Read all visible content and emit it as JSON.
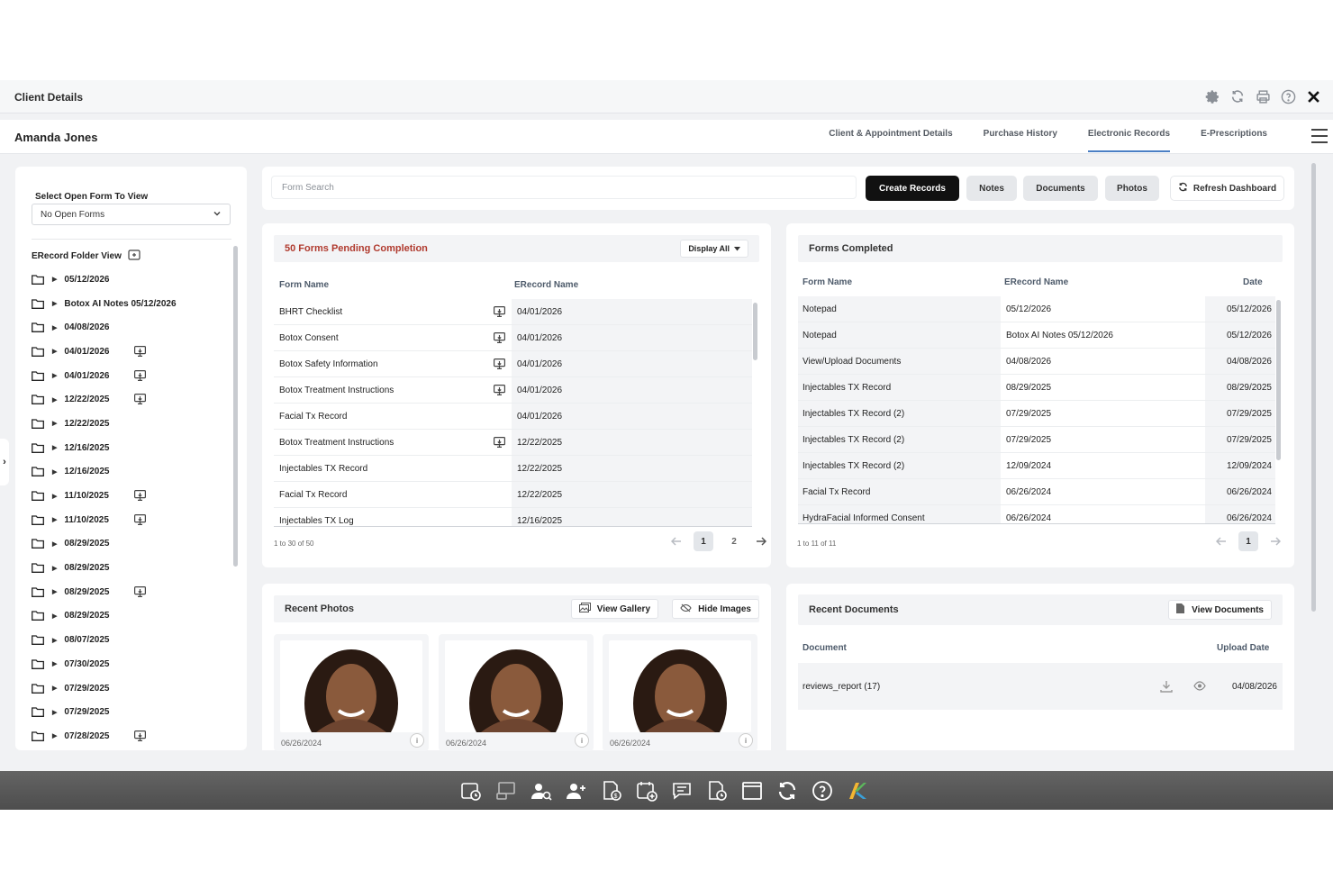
{
  "window": {
    "title": "Client Details"
  },
  "header": {
    "client_name": "Amanda Jones",
    "tabs": [
      {
        "label": "Client & Appointment Details"
      },
      {
        "label": "Purchase History"
      },
      {
        "label": "Electronic Records",
        "active": true
      },
      {
        "label": "E-Prescriptions"
      }
    ]
  },
  "sidebar": {
    "select_label": "Select Open Form To View",
    "select_value": "No Open Forms",
    "folder_view_label": "ERecord Folder View",
    "folders": [
      {
        "label": "05/12/2026",
        "has_icon": false
      },
      {
        "label": "Botox AI Notes 05/12/2026",
        "has_icon": false
      },
      {
        "label": "04/08/2026",
        "has_icon": false
      },
      {
        "label": "04/01/2026",
        "has_icon": true
      },
      {
        "label": "04/01/2026",
        "has_icon": true
      },
      {
        "label": "12/22/2025",
        "has_icon": true
      },
      {
        "label": "12/22/2025",
        "has_icon": false
      },
      {
        "label": "12/16/2025",
        "has_icon": false
      },
      {
        "label": "12/16/2025",
        "has_icon": false
      },
      {
        "label": "11/10/2025",
        "has_icon": true
      },
      {
        "label": "11/10/2025",
        "has_icon": true
      },
      {
        "label": "08/29/2025",
        "has_icon": false
      },
      {
        "label": "08/29/2025",
        "has_icon": false
      },
      {
        "label": "08/29/2025",
        "has_icon": true
      },
      {
        "label": "08/29/2025",
        "has_icon": false
      },
      {
        "label": "08/07/2025",
        "has_icon": false
      },
      {
        "label": "07/30/2025",
        "has_icon": false
      },
      {
        "label": "07/29/2025",
        "has_icon": false
      },
      {
        "label": "07/29/2025",
        "has_icon": false
      },
      {
        "label": "07/28/2025",
        "has_icon": true
      }
    ]
  },
  "toolbar": {
    "search_placeholder": "Form Search",
    "create_records": "Create Records",
    "notes": "Notes",
    "documents": "Documents",
    "photos": "Photos",
    "refresh_dashboard": "Refresh Dashboard"
  },
  "pending": {
    "title": "50 Forms Pending Completion",
    "display_btn": "Display All",
    "col_form": "Form Name",
    "col_erecord": "ERecord Name",
    "rows": [
      {
        "form": "BHRT Checklist",
        "erecord": "04/01/2026",
        "icon": true
      },
      {
        "form": "Botox Consent",
        "erecord": "04/01/2026",
        "icon": true
      },
      {
        "form": "Botox Safety Information",
        "erecord": "04/01/2026",
        "icon": true
      },
      {
        "form": "Botox Treatment Instructions",
        "erecord": "04/01/2026",
        "icon": true
      },
      {
        "form": "Facial Tx Record",
        "erecord": "04/01/2026",
        "icon": false
      },
      {
        "form": "Botox Treatment Instructions",
        "erecord": "12/22/2025",
        "icon": true
      },
      {
        "form": "Injectables TX Record",
        "erecord": "12/22/2025",
        "icon": false
      },
      {
        "form": "Facial Tx Record",
        "erecord": "12/22/2025",
        "icon": false
      },
      {
        "form": "Injectables TX Log",
        "erecord": "12/16/2025",
        "icon": false
      }
    ],
    "range_text": "1 to 30 of 50",
    "pages": [
      "1",
      "2"
    ]
  },
  "completed": {
    "title": "Forms Completed",
    "col_form": "Form Name",
    "col_erecord": "ERecord Name",
    "col_date": "Date",
    "rows": [
      {
        "form": "Notepad",
        "erecord": "05/12/2026",
        "date": "05/12/2026"
      },
      {
        "form": "Notepad",
        "erecord": "Botox AI Notes 05/12/2026",
        "date": "05/12/2026"
      },
      {
        "form": "View/Upload Documents",
        "erecord": "04/08/2026",
        "date": "04/08/2026"
      },
      {
        "form": "Injectables TX Record",
        "erecord": "08/29/2025",
        "date": "08/29/2025"
      },
      {
        "form": "Injectables TX Record (2)",
        "erecord": "07/29/2025",
        "date": "07/29/2025"
      },
      {
        "form": "Injectables TX Record (2)",
        "erecord": "07/29/2025",
        "date": "07/29/2025"
      },
      {
        "form": "Injectables TX Record (2)",
        "erecord": "12/09/2024",
        "date": "12/09/2024"
      },
      {
        "form": "Facial Tx Record",
        "erecord": "06/26/2024",
        "date": "06/26/2024"
      },
      {
        "form": "HydraFacial Informed Consent",
        "erecord": "06/26/2024",
        "date": "06/26/2024"
      }
    ],
    "range_text": "1 to 11 of 11",
    "pages": [
      "1"
    ]
  },
  "photos": {
    "title": "Recent Photos",
    "view_gallery": "View Gallery",
    "hide_images": "Hide Images",
    "items": [
      {
        "date": "06/26/2024"
      },
      {
        "date": "06/26/2024"
      },
      {
        "date": "06/26/2024"
      }
    ]
  },
  "documents": {
    "title": "Recent Documents",
    "view_documents": "View Documents",
    "col_document": "Document",
    "col_upload": "Upload Date",
    "rows": [
      {
        "name": "reviews_report (17)",
        "date": "04/08/2026"
      }
    ]
  },
  "colors": {
    "accent": "#4a7fc4",
    "pending_title": "#b03a2e",
    "dark_button": "#111111"
  }
}
